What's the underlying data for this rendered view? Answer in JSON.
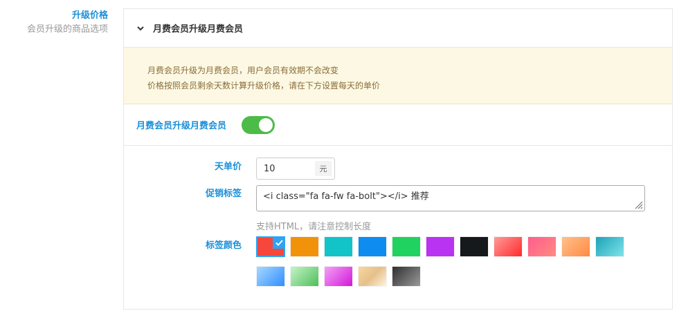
{
  "sidebar": {
    "title": "升级价格",
    "subtitle": "会员升级的商品选项"
  },
  "panel": {
    "title": "月费会员升级月费会员",
    "notice": [
      "月费会员升级为月费会员，用户会员有效期不会改变",
      "价格按照会员剩余天数计算升级价格，请在下方设置每天的单价"
    ],
    "toggle_label": "月费会员升级月费会员",
    "toggle_on": true,
    "price_label": "天单价",
    "price_value": "10",
    "price_unit": "元",
    "tag_label": "促销标签",
    "tag_value": "<i class=\"fa fa-fw fa-bolt\"></i> 推荐",
    "tag_hint": "支持HTML，请注意控制长度",
    "color_label": "标签颜色",
    "selected_color_index": 0,
    "colors": [
      {
        "name": "red",
        "bg": "#f5473c"
      },
      {
        "name": "orange",
        "bg": "#f1920a"
      },
      {
        "name": "teal",
        "bg": "#12c3c8"
      },
      {
        "name": "blue",
        "bg": "#0e8cf0"
      },
      {
        "name": "green",
        "bg": "#20d25f"
      },
      {
        "name": "purple",
        "bg": "#b934f2"
      },
      {
        "name": "black",
        "bg": "#15191c"
      },
      {
        "name": "red-gradient",
        "bg": "linear-gradient(135deg,#ff9a9a,#ff2b2b)"
      },
      {
        "name": "pink-gradient",
        "bg": "linear-gradient(135deg,#ff5d8e,#ff8a80)"
      },
      {
        "name": "peach-gradient",
        "bg": "linear-gradient(135deg,#ffc18a,#ff8a44)"
      },
      {
        "name": "cyan-gradient",
        "bg": "linear-gradient(135deg,#1ca3b7,#7fe3ea)"
      },
      {
        "name": "sky-gradient",
        "bg": "linear-gradient(135deg,#a8d8ff,#2f8fff)"
      },
      {
        "name": "mint-gradient",
        "bg": "linear-gradient(135deg,#c5f3c9,#4ebf59)"
      },
      {
        "name": "magenta-gradient",
        "bg": "linear-gradient(135deg,#f4a1f6,#d21ad8)"
      },
      {
        "name": "gold-gradient",
        "bg": "linear-gradient(135deg,#f7d8a0,#e6c08a,#fff3de)"
      },
      {
        "name": "gray-gradient",
        "bg": "linear-gradient(135deg,#2f2f2f,#9a9a9a)"
      }
    ]
  }
}
